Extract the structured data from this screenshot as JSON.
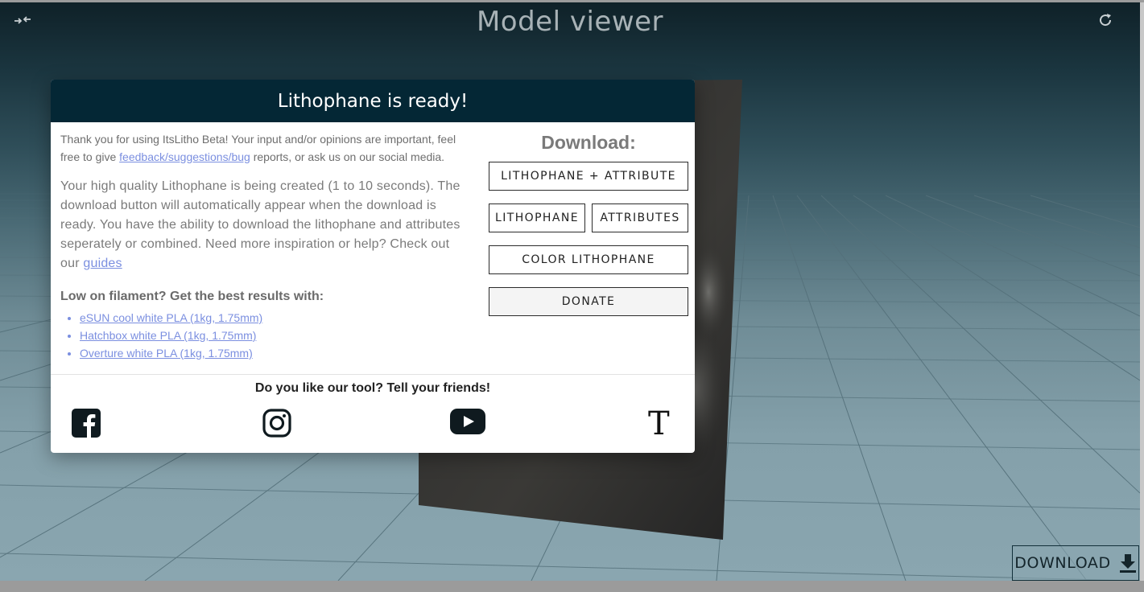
{
  "viewer": {
    "title": "Model viewer"
  },
  "modal": {
    "title": "Lithophane is ready!",
    "intro_before": "Thank you for using ItsLitho Beta! Your input and/or opinions are important, feel free to give ",
    "intro_link": "feedback/suggestions/bug",
    "intro_after": " reports, or ask us on our social media.",
    "desc_text": "Your high quality Lithophane is being created (1 to 10 seconds). The download button will automatically appear when the download is ready. You have the ability to download the lithophane and attributes seperately or combined. Need more inspiration or help? Check out our ",
    "desc_link": "guides",
    "filament_title": "Low on filament? Get the best results with:",
    "filaments": [
      "eSUN cool white PLA (1kg, 1.75mm)",
      "Hatchbox white PLA (1kg, 1.75mm)",
      "Overture white PLA (1kg, 1.75mm)"
    ],
    "download_title": "Download:",
    "buttons": {
      "combined": "LITHOPHANE + ATTRIBUTE",
      "lithophane": "LITHOPHANE",
      "attributes": "ATTRIBUTES",
      "color": "COLOR LITHOPHANE",
      "donate": "DONATE"
    },
    "share_text": "Do you like our tool? Tell your friends!",
    "social": {
      "facebook_icon": "facebook-icon",
      "instagram_icon": "instagram-icon",
      "youtube_icon": "youtube-icon",
      "t_glyph": "T"
    }
  },
  "download_button": {
    "label": "DOWNLOAD"
  },
  "colors": {
    "header_bg": "#042735",
    "link": "#7b8fe0",
    "viewer_top": "#0f2128",
    "viewer_bottom": "#8aa6b0"
  }
}
